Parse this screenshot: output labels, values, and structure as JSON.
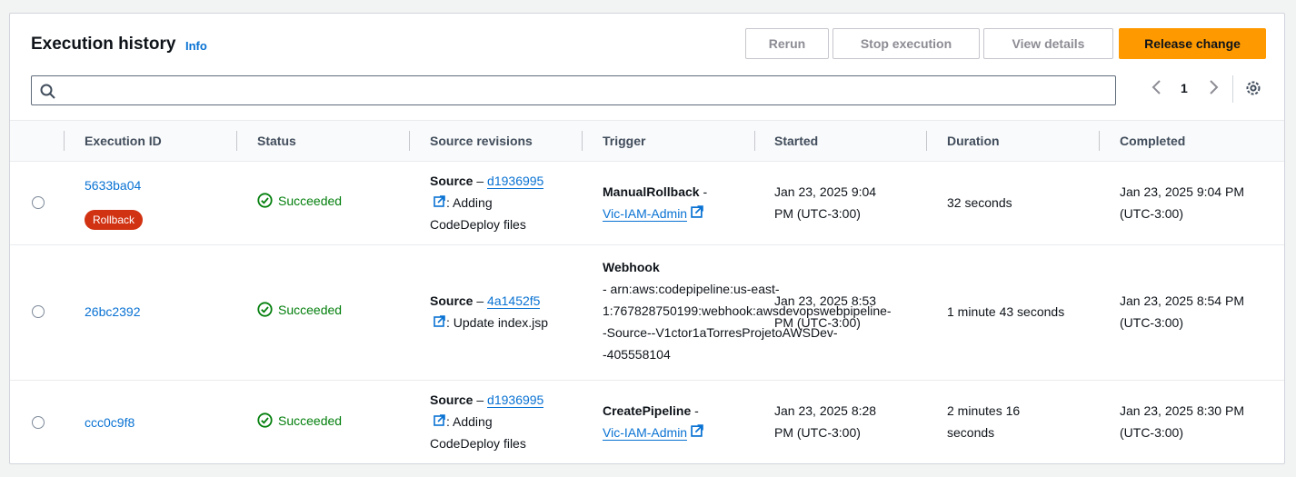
{
  "header": {
    "title": "Execution history",
    "info_label": "Info"
  },
  "actions": {
    "rerun": "Rerun",
    "stop": "Stop execution",
    "view": "View details",
    "release": "Release change"
  },
  "search": {
    "value": "",
    "placeholder": ""
  },
  "pagination": {
    "current_page": "1"
  },
  "columns": [
    "Execution ID",
    "Status",
    "Source revisions",
    "Trigger",
    "Started",
    "Duration",
    "Completed"
  ],
  "rows": [
    {
      "id": "5633ba04",
      "badge": "Rollback",
      "status": "Succeeded",
      "source_label": "Source",
      "source_sep": " – ",
      "revision": "d1936995",
      "message_a": ": Adding",
      "message_b": "CodeDeploy files",
      "trigger_type": "ManualRollback",
      "trigger_sep": " -",
      "trigger_user": "Vic-IAM-Admin",
      "started_a": "Jan 23, 2025 9:04",
      "started_b": "PM (UTC-3:00)",
      "duration": "32 seconds",
      "completed_a": "Jan 23, 2025 9:04 PM",
      "completed_b": "(UTC-3:00)"
    },
    {
      "id": "26bc2392",
      "status": "Succeeded",
      "source_label": "Source",
      "source_sep": " – ",
      "revision": "4a1452f5",
      "message_a": ": Update index.jsp",
      "trigger_type": "Webhook",
      "trigger_l1": "- arn:aws:codepipeline:us-east-",
      "trigger_l2": "1:767828750199:webhook:awsdevopswebpipeline-",
      "trigger_l3": "-Source--V1ctor1aTorresProjetoAWSDev-",
      "trigger_l4": "-405558104",
      "started_a": "Jan 23, 2025 8:53",
      "started_b": "PM (UTC-3:00)",
      "duration": "1 minute 43 seconds",
      "completed_a": "Jan 23, 2025 8:54 PM",
      "completed_b": "(UTC-3:00)"
    },
    {
      "id": "ccc0c9f8",
      "status": "Succeeded",
      "source_label": "Source",
      "source_sep": " – ",
      "revision": "d1936995",
      "message_a": ": Adding",
      "message_b": "CodeDeploy files",
      "trigger_type": "CreatePipeline",
      "trigger_sep": " -",
      "trigger_user": "Vic-IAM-Admin",
      "started_a": "Jan 23, 2025 8:28",
      "started_b": "PM (UTC-3:00)",
      "duration_a": "2 minutes 16",
      "duration_b": "seconds",
      "completed_a": "Jan 23, 2025 8:30 PM",
      "completed_b": "(UTC-3:00)"
    }
  ],
  "icons": {
    "search": "search-icon",
    "prev": "chevron-left-icon",
    "next": "chevron-right-icon",
    "settings": "gear-icon",
    "external": "external-link-icon",
    "success": "check-circle-icon"
  },
  "colors": {
    "accent": "#ff9900",
    "link": "#0972d3",
    "success": "#037f0c",
    "rollback_badge": "#d13212"
  }
}
